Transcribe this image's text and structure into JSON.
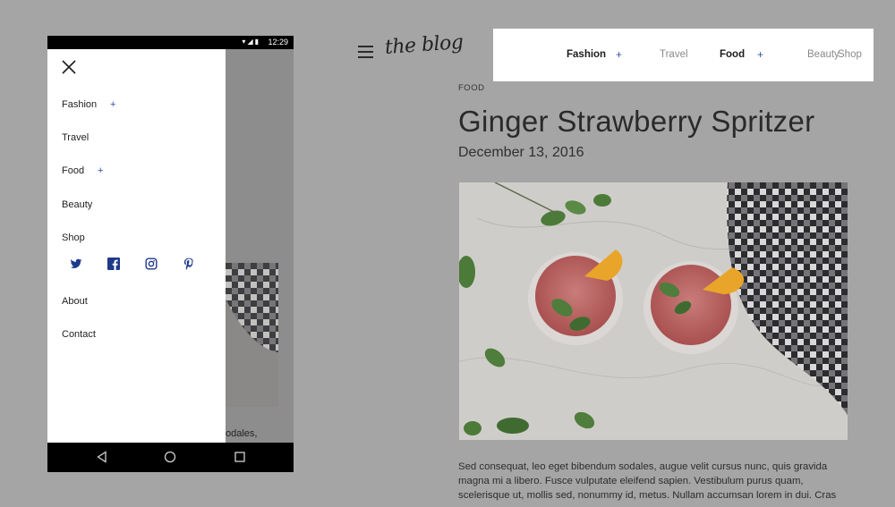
{
  "desktop": {
    "logo": "the blog",
    "nav": [
      {
        "label": "Fashion",
        "has_submenu": true
      },
      {
        "label": "Travel",
        "has_submenu": false
      },
      {
        "label": "Food",
        "has_submenu": true
      },
      {
        "label": "Beauty",
        "has_submenu": false
      },
      {
        "label": "Shop",
        "has_submenu": false
      }
    ],
    "plus_symbol": "+",
    "post": {
      "category": "FOOD",
      "title": "Ginger Strawberry Spritzer",
      "date": "December 13, 2016",
      "body": "Sed consequat, leo eget bibendum sodales, augue velit cursus nunc, quis gravida magna mi a libero. Fusce vulputate eleifend sapien. Vestibulum purus quam, scelerisque ut, mollis sed, nonummy id, metus. Nullam accumsan lorem in dui. Cras"
    }
  },
  "phone": {
    "status_time": "12:29",
    "background_text": "odales,",
    "menu": [
      {
        "label": "Fashion",
        "has_submenu": true
      },
      {
        "label": "Travel",
        "has_submenu": false
      },
      {
        "label": "Food",
        "has_submenu": true
      },
      {
        "label": "Beauty",
        "has_submenu": false
      },
      {
        "label": "Shop",
        "has_submenu": false
      }
    ],
    "social_icons": [
      "twitter-icon",
      "facebook-icon",
      "instagram-icon",
      "pinterest-icon"
    ],
    "secondary_menu": [
      {
        "label": "About"
      },
      {
        "label": "Contact"
      }
    ],
    "nav_buttons": [
      "back-icon",
      "home-icon",
      "recents-icon"
    ]
  },
  "colors": {
    "overlay_gray": "#a5a5a5",
    "accent_blue": "#2f4fa3",
    "social_blue": "#1d3a8a"
  }
}
